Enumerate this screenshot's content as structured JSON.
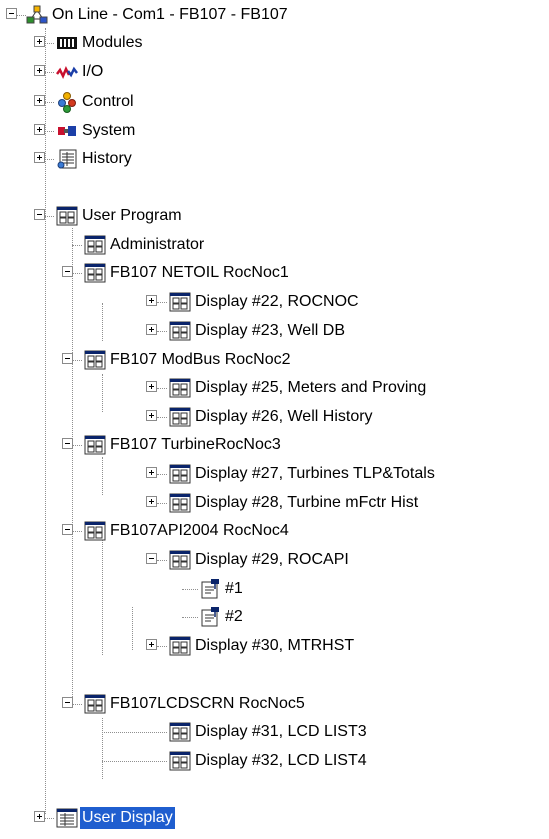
{
  "tree": {
    "root": "On Line - Com1 - FB107 - FB107",
    "modules": "Modules",
    "io": "I/O",
    "control": "Control",
    "system": "System",
    "history": "History",
    "user_program": "User Program",
    "administrator": "Administrator",
    "netoil": "FB107 NETOIL RocNoc1",
    "display22": "Display #22, ROCNOC",
    "display23": "Display #23, Well DB",
    "modbus": "FB107 ModBus RocNoc2",
    "display25": "Display #25, Meters and Proving",
    "display26": "Display #26, Well History",
    "turbine": "FB107 TurbineRocNoc3",
    "display27": "Display #27, Turbines TLP&Totals",
    "display28": "Display #28, Turbine mFctr Hist",
    "api2004": "FB107API2004 RocNoc4",
    "display29": "Display #29, ROCAPI",
    "item1": "#1",
    "item2": "#2",
    "display30": "Display #30, MTRHST",
    "lcdscrn": "FB107LCDSCRN RocNoc5",
    "display31": "Display #31, LCD LIST3",
    "display32": "Display #32, LCD LIST4",
    "user_display": "User Display"
  },
  "icons": {
    "root": "network-icon",
    "modules": "module-rack-icon",
    "io": "io-icon",
    "control": "control-icon",
    "system": "system-icon",
    "history": "history-icon",
    "program": "program-grid-icon",
    "point": "point-edit-icon",
    "user_display": "user-display-icon"
  },
  "colors": {
    "selection": "#1f5ecf",
    "grid_icon_header": "#0a246a",
    "guide_line": "#8f8f8f"
  }
}
